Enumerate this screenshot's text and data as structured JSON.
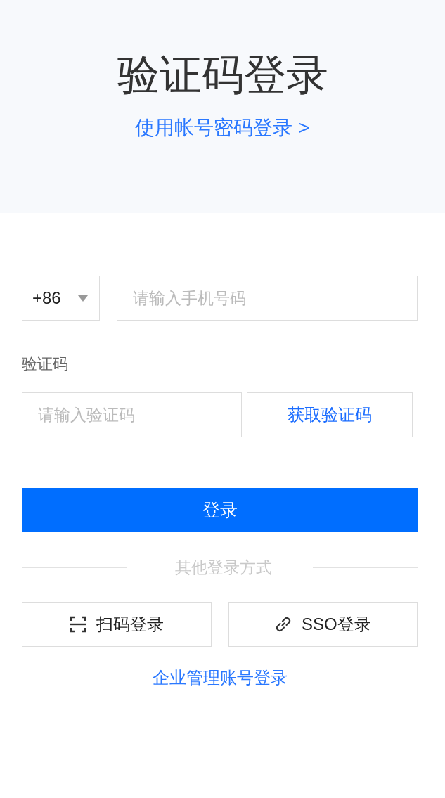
{
  "header": {
    "title": "验证码登录",
    "switch_link": "使用帐号密码登录 >"
  },
  "form": {
    "country_code": "+86",
    "phone": {
      "placeholder": "请输入手机号码"
    },
    "code_label": "验证码",
    "code": {
      "placeholder": "请输入验证码"
    },
    "get_code_button": "获取验证码",
    "submit_button": "登录"
  },
  "other": {
    "divider_label": "其他登录方式",
    "methods": [
      {
        "kind": "qr",
        "label": "扫码登录"
      },
      {
        "kind": "sso",
        "label": "SSO登录"
      }
    ],
    "enterprise_link": "企业管理账号登录"
  }
}
